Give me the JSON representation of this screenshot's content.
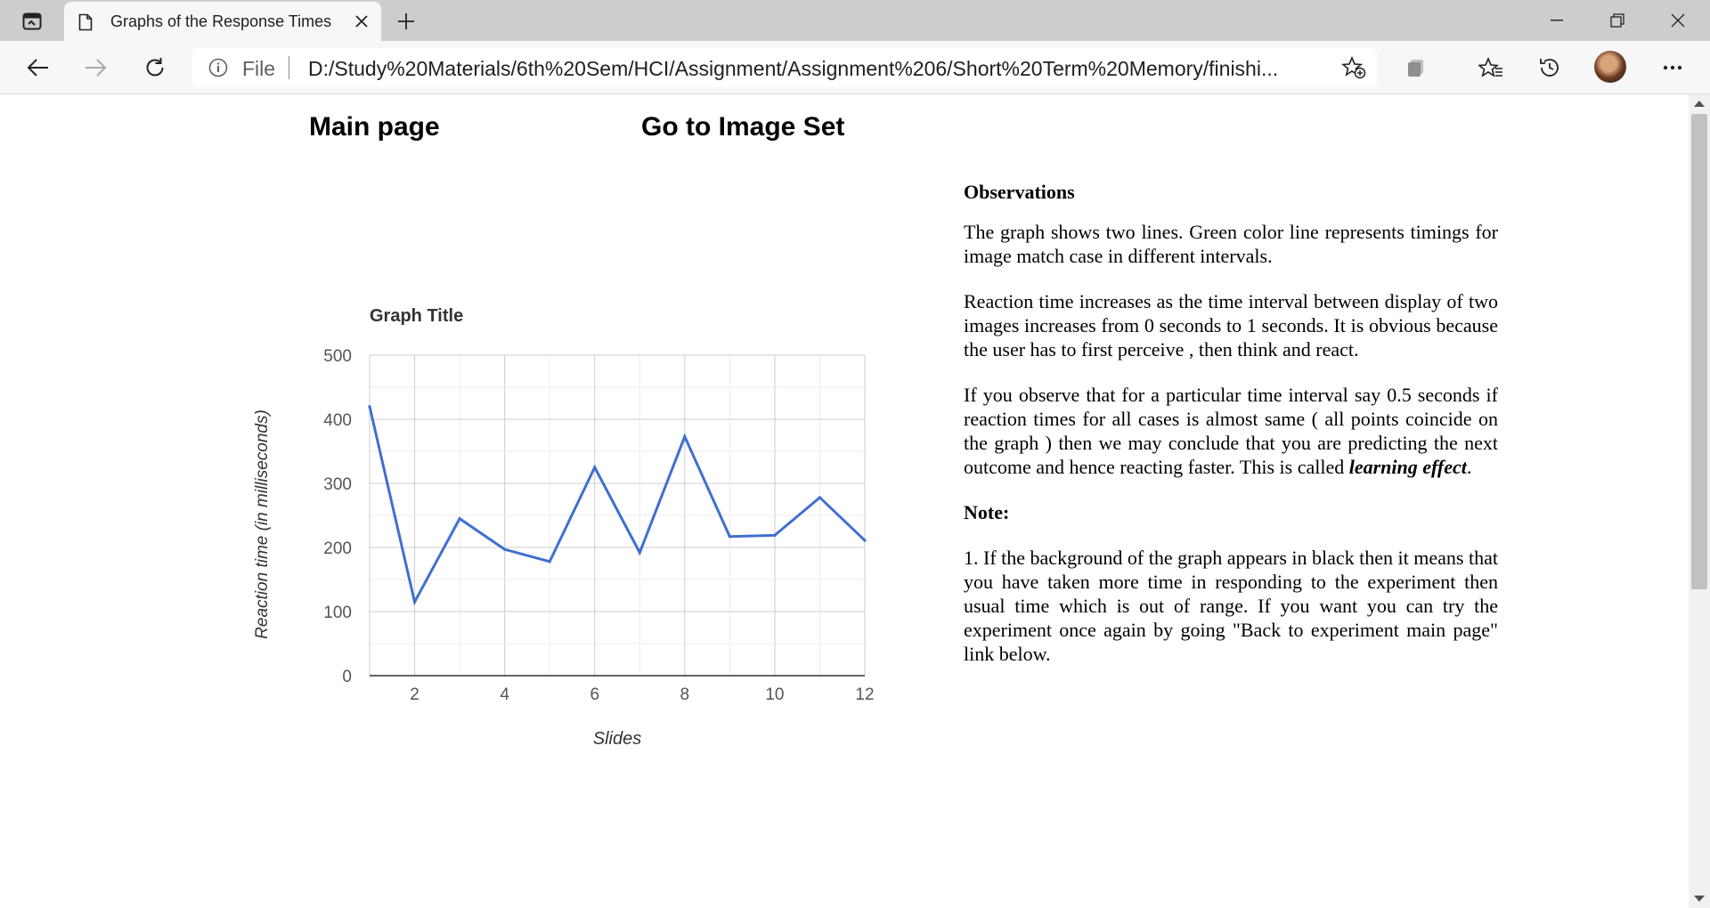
{
  "browser": {
    "tab_title": "Graphs of the Response Times",
    "address_scheme": "File",
    "address_url": "D:/Study%20Materials/6th%20Sem/HCI/Assignment/Assignment%206/Short%20Term%20Memory/finishi...",
    "icons": [
      "tab-actions-icon",
      "page-icon",
      "close-icon",
      "plus-icon",
      "minimize-icon",
      "restore-icon",
      "close-window-icon",
      "back-icon",
      "forward-icon",
      "reload-icon",
      "info-icon",
      "add-favorite-icon",
      "collections-icon",
      "favorites-icon",
      "history-icon",
      "avatar",
      "more-icon"
    ]
  },
  "page": {
    "nav": {
      "main_page": "Main page",
      "image_set": "Go to Image Set"
    },
    "observations": {
      "heading": "Observations",
      "p1": "The graph shows two lines. Green color line represents timings for image match case in different intervals.",
      "p2": "Reaction time increases as the time interval between display of two images increases from 0 seconds to 1 seconds. It is obvious because the user has to first perceive , then think and react.",
      "p3_before": "If you observe that for a particular time interval say 0.5 seconds if reaction times for all cases is almost same ( all points coincide on the graph ) then we may conclude that you are predicting the next outcome and hence reacting faster. This is called ",
      "p3_emphasis": "learning effect",
      "p3_after": ".",
      "note_heading": "Note:",
      "note_1": "1. If the background of the graph appears in black then it means that you have taken more time in responding to the experiment then usual time which is out of range. If you want you can try the experiment once again by going \"Back to experiment main page\" link below."
    }
  },
  "chart_data": {
    "type": "line",
    "title": "Graph Title",
    "xlabel": "Slides",
    "ylabel": "Reaction time (in milliseconds)",
    "x": [
      1,
      2,
      3,
      4,
      5,
      6,
      7,
      8,
      9,
      10,
      11,
      12
    ],
    "series": [
      {
        "color": "#3f6fd0",
        "values": [
          420,
          115,
          245,
          197,
          178,
          325,
          192,
          373,
          217,
          219,
          278,
          211
        ]
      }
    ],
    "xlim": [
      1,
      12
    ],
    "ylim": [
      0,
      500
    ],
    "xticks": [
      2,
      4,
      6,
      8,
      10,
      12
    ],
    "yticks": [
      0,
      100,
      200,
      300,
      400,
      500
    ],
    "grid": true,
    "legend": "none"
  }
}
